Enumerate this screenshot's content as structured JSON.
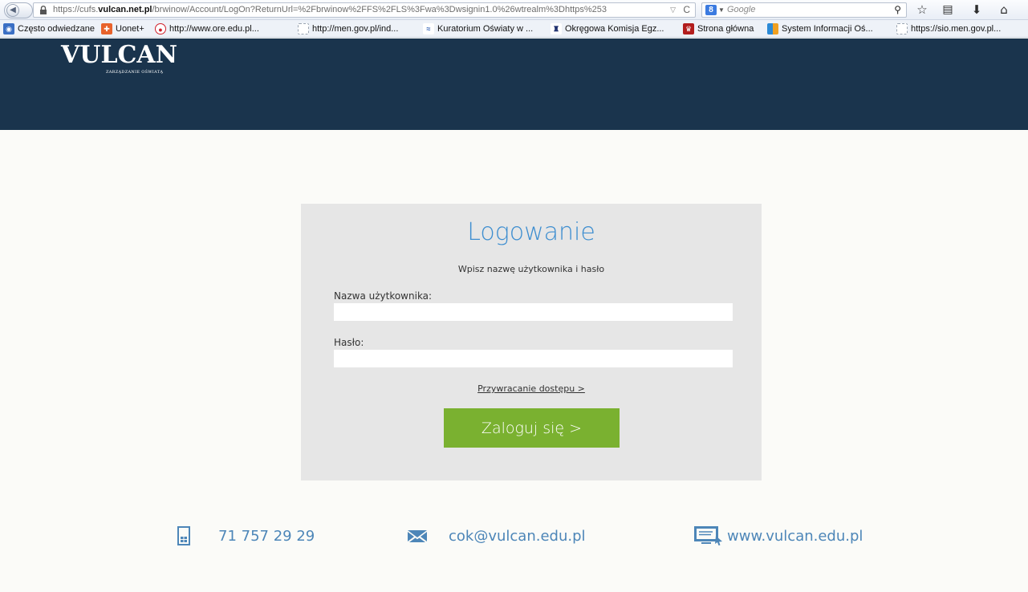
{
  "browser": {
    "url_prefix": "https://cufs.",
    "url_domain": "vulcan.net.pl",
    "url_path": "/brwinow/Account/LogOn?ReturnUrl=%2Fbrwinow%2FFS%2FLS%3Fwa%3Dwsignin1.0%26wtrealm%3Dhttps%253",
    "search_placeholder": "Google",
    "bookmarks": [
      {
        "label": "Często odwiedzane",
        "icon": "globe-icon",
        "color": "#3a6fc4"
      },
      {
        "label": "Uonet+",
        "icon": "uonet-icon",
        "color": "#e8632b"
      },
      {
        "label": "http://www.ore.edu.pl...",
        "icon": "ore-icon",
        "color": "#d0202a"
      },
      {
        "label": "http://men.gov.pl/ind...",
        "icon": "page-icon",
        "color": "#9aa4b1"
      },
      {
        "label": "Kuratorium Oświaty w ...",
        "icon": "kuratorium-icon",
        "color": "#2f5fb5"
      },
      {
        "label": "Okręgowa Komisja Egz...",
        "icon": "oke-icon",
        "color": "#1d2f6e"
      },
      {
        "label": "Strona główna",
        "icon": "crest-icon",
        "color": "#b21d1d"
      },
      {
        "label": "System Informacji Oś...",
        "icon": "sio-icon",
        "color": "#2c8ad6"
      },
      {
        "label": "https://sio.men.gov.pl...",
        "icon": "page-icon",
        "color": "#9aa4b1"
      }
    ]
  },
  "header": {
    "logo": "VULCAN",
    "tagline": "ZARZĄDZANIE OŚWIATĄ",
    "background": "#1a344d"
  },
  "login": {
    "title": "Logowanie",
    "subtitle": "Wpisz nazwę użytkownika i hasło",
    "username_label": "Nazwa użytkownika:",
    "username_value": "",
    "password_label": "Hasło:",
    "password_value": "",
    "recover_link": "Przywracanie dostępu >",
    "submit_label": "Zaloguj się >",
    "accent": "#3e8ed0",
    "button_color": "#7ab130"
  },
  "footer": {
    "phone": "71 757 29 29",
    "email": "cok@vulcan.edu.pl",
    "website": "www.vulcan.edu.pl",
    "color": "#4d86b8"
  }
}
